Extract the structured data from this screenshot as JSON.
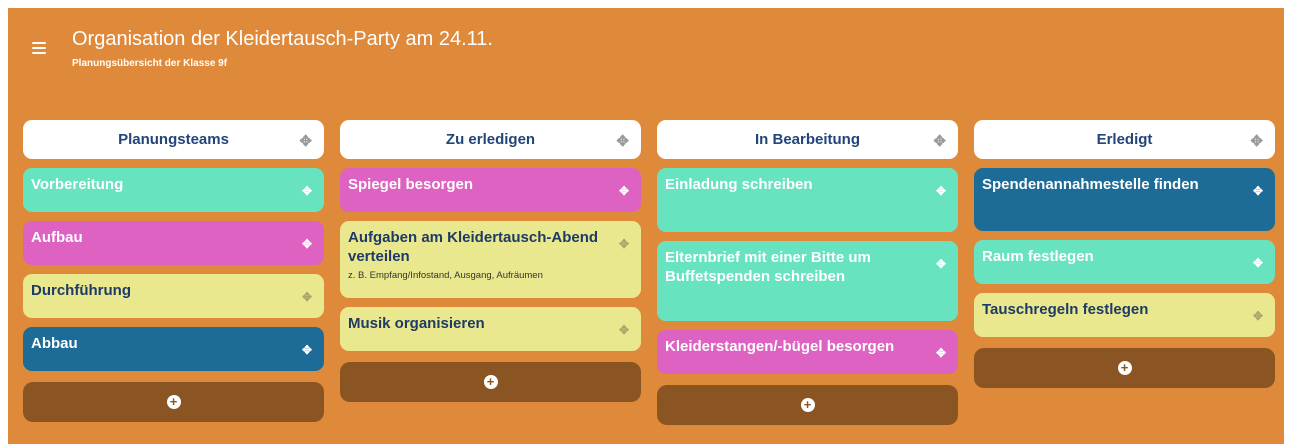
{
  "header": {
    "title": "Organisation der Kleidertausch-Party am 24.11.",
    "subtitle": "Planungsübersicht der Klasse 9f"
  },
  "icons": {
    "menu": "hamburger-icon",
    "move": "move-icon",
    "add": "plus-circle-icon"
  },
  "colors": {
    "board": "#df8a3a",
    "teal": "#68e3bf",
    "pink": "#dd62c1",
    "yellow": "#eae88e",
    "blue": "#1d6c97",
    "add": "#8a5423"
  },
  "columns": [
    {
      "title": "Planungsteams",
      "cards": [
        {
          "title": "Vorbereitung",
          "color": "teal"
        },
        {
          "title": "Aufbau",
          "color": "pink"
        },
        {
          "title": "Durchführung",
          "color": "yellow"
        },
        {
          "title": "Abbau",
          "color": "blue"
        }
      ]
    },
    {
      "title": "Zu erledigen",
      "cards": [
        {
          "title": "Spiegel besorgen",
          "color": "pink"
        },
        {
          "title": "Aufgaben am Kleidertausch-Abend verteilen",
          "subtitle": "z. B. Empfang/Infostand, Ausgang, Aufräumen",
          "color": "yellow"
        },
        {
          "title": "Musik organisieren",
          "color": "yellow"
        }
      ]
    },
    {
      "title": "In Bearbeitung",
      "cards": [
        {
          "title": "Einladung schreiben",
          "color": "teal"
        },
        {
          "title": "Elternbrief mit einer Bitte um Buffetspenden schreiben",
          "color": "teal"
        },
        {
          "title": "Kleiderstangen/-bügel besorgen",
          "color": "pink"
        }
      ]
    },
    {
      "title": "Erledigt",
      "cards": [
        {
          "title": "Spendenannahmestelle finden",
          "color": "blue"
        },
        {
          "title": "Raum festlegen",
          "color": "teal"
        },
        {
          "title": "Tauschregeln festlegen",
          "color": "yellow"
        }
      ]
    }
  ]
}
